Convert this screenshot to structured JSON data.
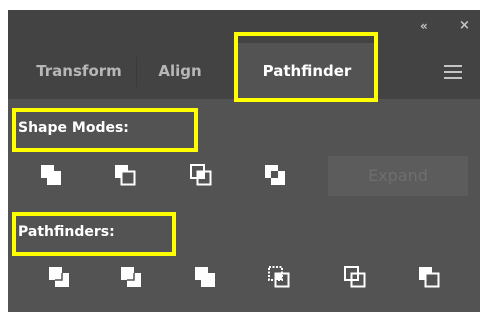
{
  "titlebar": {
    "collapse_glyph": "«",
    "close_glyph": "×",
    "collapse_icon": "double-chevron-left-icon",
    "close_icon": "close-icon"
  },
  "tabs": [
    {
      "label": "Transform",
      "active": false
    },
    {
      "label": "Align",
      "active": false
    },
    {
      "label": "Pathfinder",
      "active": true
    }
  ],
  "menu_icon": "panel-menu-icon",
  "highlight_color": "#ffff00",
  "shape_modes": {
    "label": "Shape Modes:",
    "buttons": [
      "unite-icon",
      "minus-front-icon",
      "intersect-icon",
      "exclude-icon"
    ],
    "expand_label": "Expand",
    "expand_enabled": false
  },
  "pathfinders": {
    "label": "Pathfinders:",
    "buttons": [
      "divide-icon",
      "trim-icon",
      "merge-icon",
      "crop-icon",
      "outline-icon",
      "minus-back-icon"
    ]
  }
}
